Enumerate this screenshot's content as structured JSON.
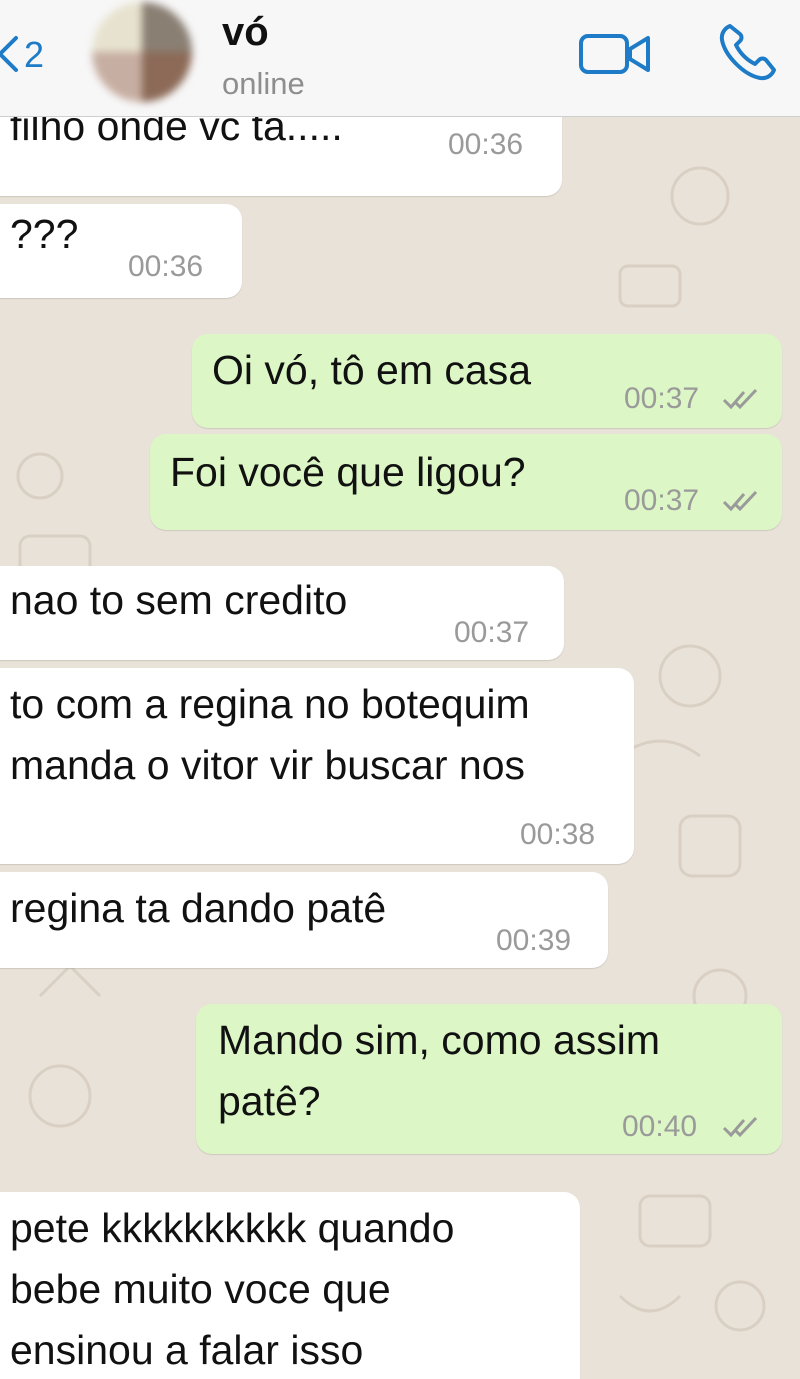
{
  "header": {
    "back_count": "2",
    "contact_name": "vó",
    "contact_status": "online",
    "icons": {
      "back": "chevron-left-icon",
      "video": "video-camera-icon",
      "call": "phone-icon"
    },
    "accent_color": "#1e7bc7"
  },
  "colors": {
    "incoming_bubble": "#ffffff",
    "outgoing_bubble": "#dcf7c5",
    "wallpaper": "#e9e2d8"
  },
  "messages": [
    {
      "direction": "in",
      "text": "filho onde vc ta.....",
      "time": "00:36"
    },
    {
      "direction": "in",
      "text": "???",
      "time": "00:36"
    },
    {
      "direction": "out",
      "text": "Oi vó, tô em casa",
      "time": "00:37",
      "status": "read"
    },
    {
      "direction": "out",
      "text": "Foi você que ligou?",
      "time": "00:37",
      "status": "read"
    },
    {
      "direction": "in",
      "text": "nao to sem credito",
      "time": "00:37"
    },
    {
      "direction": "in",
      "text": "to com a regina no botequim\nmanda o vitor vir buscar nos",
      "time": "00:38"
    },
    {
      "direction": "in",
      "text": "regina ta dando patê",
      "time": "00:39"
    },
    {
      "direction": "out",
      "text": "Mando sim, como assim\npatê?",
      "time": "00:40",
      "status": "read"
    },
    {
      "direction": "in",
      "text": "pete kkkkkkkkkk quando\nbebe muito voce que\nensinou a falar isso",
      "time": ""
    }
  ]
}
